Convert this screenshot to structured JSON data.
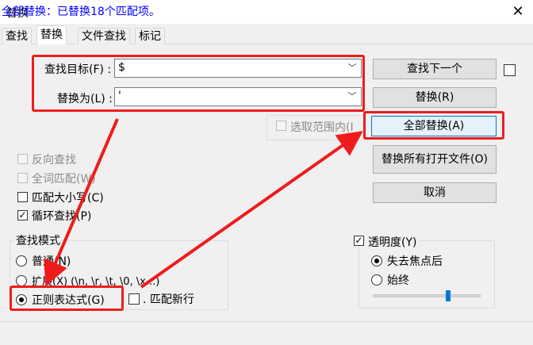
{
  "window": {
    "title": "替换",
    "close_glyph": "✕"
  },
  "tabs": [
    {
      "label": "查找"
    },
    {
      "label": "替换"
    },
    {
      "label": "文件查找"
    },
    {
      "label": "标记"
    }
  ],
  "find": {
    "label": "查找目标(F) :",
    "value": "$"
  },
  "replace": {
    "label": "替换为(L) :",
    "value": "'"
  },
  "selection_only": {
    "label": "选取范围内(I"
  },
  "buttons": {
    "find_next": "查找下一个",
    "replace": "替换(R)",
    "replace_all": "全部替换(A)",
    "replace_all_open": "替换所有打开文件(O)",
    "cancel": "取消"
  },
  "options": {
    "backward": "反向查找",
    "whole_word": "全词匹配(W)",
    "match_case": "匹配大小写(C)",
    "wrap": "循环查找(P)"
  },
  "search_mode": {
    "title": "查找模式",
    "normal": "普通(N)",
    "extended": "扩展(X) (\\n, \\r, \\t, \\0, \\x...)",
    "regex": "正则表达式(G)",
    "dot_newline": ". 匹配新行"
  },
  "transparency": {
    "title": "透明度(Y)",
    "on_lose_focus": "失去焦点后",
    "always": "始终",
    "level_fraction": 0.7
  },
  "status": {
    "text": "全部替换：已替换18个匹配项。"
  },
  "colors": {
    "annotation_red": "#ee1c1c",
    "status_blue": "#0000ff",
    "focus_blue": "#0078d7"
  }
}
